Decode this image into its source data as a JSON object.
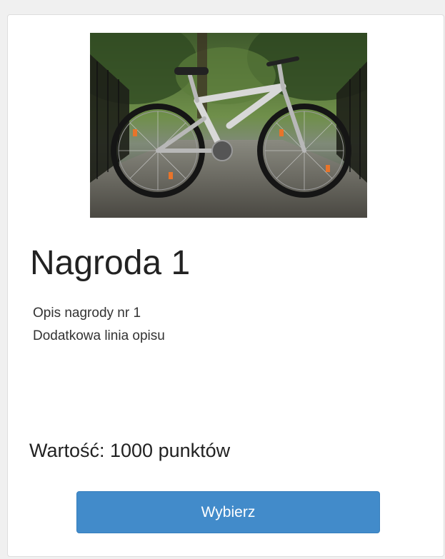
{
  "prize": {
    "title": "Nagroda 1",
    "description_lines": [
      "Opis nagrody nr 1",
      "Dodatkowa linia opisu"
    ],
    "value_text": "Wartość: 1000 punktów",
    "button_label": "Wybierz",
    "image_subject": "full-suspension mountain bike on a bridge"
  },
  "colors": {
    "accent": "#428bca",
    "button_border": "#357ebd",
    "card_border": "#dddddd",
    "text": "#222222"
  }
}
